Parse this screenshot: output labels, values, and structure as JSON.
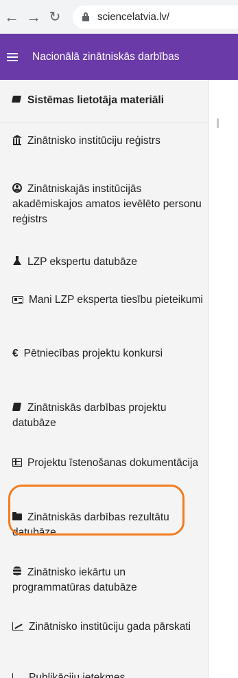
{
  "browser": {
    "url": "sciencelatvia.lv/"
  },
  "header": {
    "title": "Nacionālā zinātniskās darbības"
  },
  "sidebar": {
    "items": [
      {
        "label": "Sistēmas lietotāja materiāli",
        "icon": "folder-open-icon"
      },
      {
        "label": "Zinātnisko institūciju reģistrs",
        "icon": "bank-icon"
      },
      {
        "label": "Zinātniskajās institūcijās akadēmiskajos amatos ievēlēto personu reģistrs",
        "icon": "user-circle-icon"
      },
      {
        "label": "LZP ekspertu datubāze",
        "icon": "flask-icon"
      },
      {
        "label": "Mani LZP eksperta tiesību pieteikumi",
        "icon": "idcard-icon"
      },
      {
        "label": "Pētniecības projektu konkursi",
        "icon": "euro-icon",
        "glyph": "€"
      },
      {
        "label": "Zinātniskās darbības projektu datubāze",
        "icon": "book-icon"
      },
      {
        "label": "Projektu īstenošanas dokumentācija",
        "icon": "table-icon"
      },
      {
        "label": "Zinātniskās darbības rezultātu datubāze",
        "icon": "folder-icon"
      },
      {
        "label": "Zinātnisko iekārtu un programmatūras datubāze",
        "icon": "database-icon"
      },
      {
        "label": "Zinātnisko institūciju gada pārskati",
        "icon": "chart-line-icon"
      },
      {
        "label": "Publikāciju ietekmes",
        "icon": "chart-bar-icon"
      }
    ]
  },
  "colors": {
    "header_bg": "#6a3aa8",
    "highlight": "#f47b1e",
    "sidebar_bg": "#f4f4f4"
  }
}
